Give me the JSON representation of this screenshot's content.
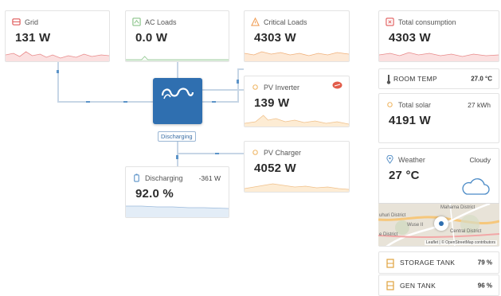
{
  "grid": {
    "title": "Grid",
    "value": "131 W",
    "icon": "grid-plug-icon",
    "color": "#e05a5a"
  },
  "ac_loads": {
    "title": "AC Loads",
    "value": "0.0 W",
    "icon": "ac-loads-icon",
    "color": "#8bc48a"
  },
  "critical_loads": {
    "title": "Critical Loads",
    "value": "4303 W",
    "icon": "warning-triangle-icon",
    "color": "#f0a05a"
  },
  "pv_inverter": {
    "title": "PV Inverter",
    "value": "139 W",
    "icon": "sun-icon",
    "color": "#f0b96a",
    "alert_icon": "tag-alert-icon"
  },
  "pv_charger": {
    "title": "PV Charger",
    "value": "4052 W",
    "icon": "sun-icon",
    "color": "#f0b96a"
  },
  "battery": {
    "title": "Discharging",
    "power": "-361 W",
    "value": "92.0 %",
    "icon": "battery-icon",
    "color": "#5b93c8"
  },
  "inverter_status": "Discharging",
  "total_consumption": {
    "title": "Total consumption",
    "value": "4303 W",
    "icon": "consumption-icon",
    "color": "#e05a5a"
  },
  "room_temp": {
    "label": "ROOM TEMP",
    "value": "27.0 °C",
    "icon": "thermometer-icon"
  },
  "total_solar": {
    "title": "Total solar",
    "energy": "27 kWh",
    "value": "4191 W",
    "icon": "sun-icon"
  },
  "weather": {
    "title": "Weather",
    "condition": "Cloudy",
    "value": "27 °C",
    "icon": "location-pin-icon",
    "condition_icon": "cloud-icon"
  },
  "map": {
    "labels": [
      "Mahama District",
      "uhuri District",
      "Wuse II",
      "Central District",
      "e District"
    ],
    "attribution": "Leaflet | © OpenStreetMap contributors"
  },
  "tanks": [
    {
      "label": "STORAGE TANK",
      "value": "79 %",
      "icon": "tank-icon"
    },
    {
      "label": "GEN TANK",
      "value": "96 %",
      "icon": "tank-icon"
    }
  ]
}
